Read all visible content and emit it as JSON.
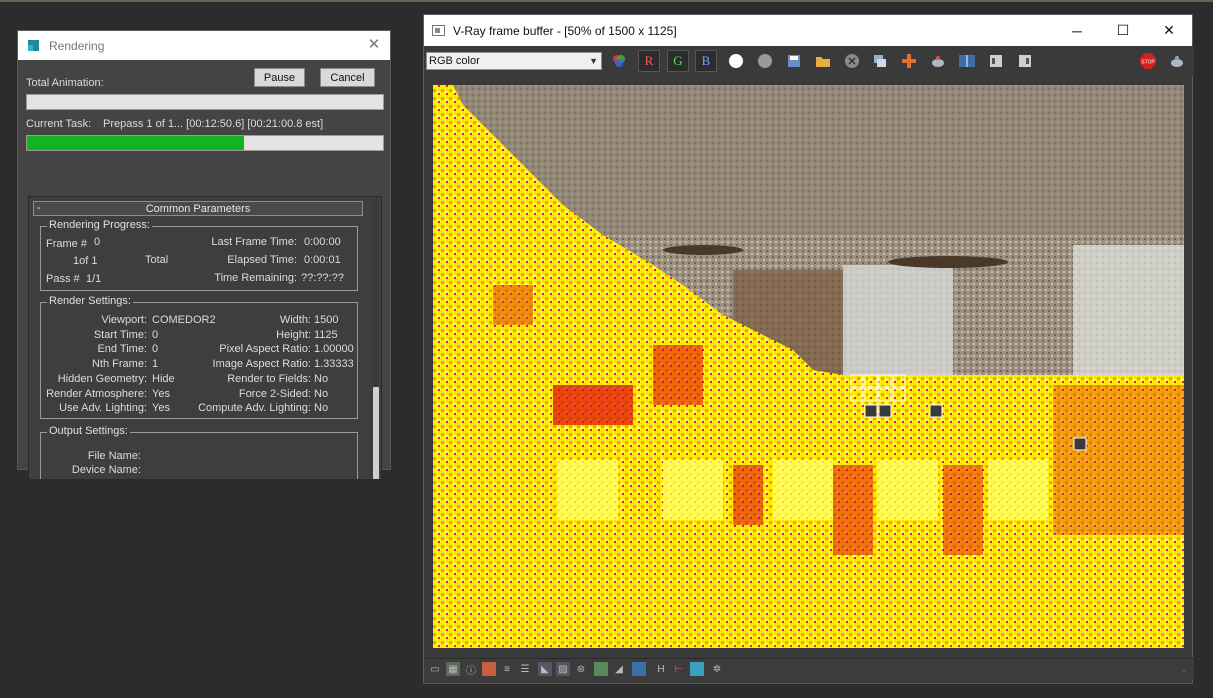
{
  "rendering_dialog": {
    "title": "Rendering",
    "total_animation_label": "Total Animation:",
    "pause_label": "Pause",
    "cancel_label": "Cancel",
    "total_animation_progress": 0.0,
    "current_task_label": "Current Task:",
    "current_task_value": "Prepass 1 of 1... [00:12:50.6] [00:21:00.8 est]",
    "current_task_progress": 0.61,
    "common_parameters": {
      "header": "Common Parameters",
      "collapse_symbol": "-",
      "rendering_progress": {
        "title": "Rendering Progress:",
        "frame_label": "Frame #",
        "frame_value": "0",
        "of_value": "1of 1",
        "total_label": "Total",
        "pass_label": "Pass #",
        "pass_value": "1/1",
        "last_frame_time_label": "Last Frame Time:",
        "last_frame_time_value": "0:00:00",
        "elapsed_time_label": "Elapsed Time:",
        "elapsed_time_value": "0:00:01",
        "time_remaining_label": "Time Remaining:",
        "time_remaining_value": "??:??:??"
      },
      "render_settings": {
        "title": "Render Settings:",
        "left": [
          {
            "label": "Viewport:",
            "value": "COMEDOR2"
          },
          {
            "label": "Start Time:",
            "value": "0"
          },
          {
            "label": "End Time:",
            "value": "0"
          },
          {
            "label": "Nth Frame:",
            "value": "1"
          },
          {
            "label": "Hidden Geometry:",
            "value": "Hide"
          },
          {
            "label": "Render Atmosphere:",
            "value": "Yes"
          },
          {
            "label": "Use Adv. Lighting:",
            "value": "Yes"
          }
        ],
        "right": [
          {
            "label": "Width:",
            "value": "1500"
          },
          {
            "label": "Height:",
            "value": "1125"
          },
          {
            "label": "Pixel Aspect Ratio:",
            "value": "1.00000"
          },
          {
            "label": "Image Aspect Ratio:",
            "value": "1.33333"
          },
          {
            "label": "Render to Fields:",
            "value": "No"
          },
          {
            "label": "Force 2-Sided:",
            "value": "No"
          },
          {
            "label": "Compute Adv. Lighting:",
            "value": "No"
          }
        ]
      },
      "output_settings": {
        "title": "Output Settings:",
        "file_name_label": "File Name:",
        "device_name_label": "Device Name:"
      }
    }
  },
  "vfb": {
    "title": "V-Ray frame buffer - [50% of 1500 x 1125]",
    "minimize": "─",
    "maximize": "☐",
    "close": "✕",
    "channel": "RGB color",
    "r_label": "R",
    "g_label": "G",
    "b_label": "B",
    "stop_label": "STOP",
    "bottom_h_label": "H"
  },
  "colors": {
    "progress_green": "#15b324",
    "render_yellow": "#ffef00",
    "render_red": "#e01010"
  }
}
